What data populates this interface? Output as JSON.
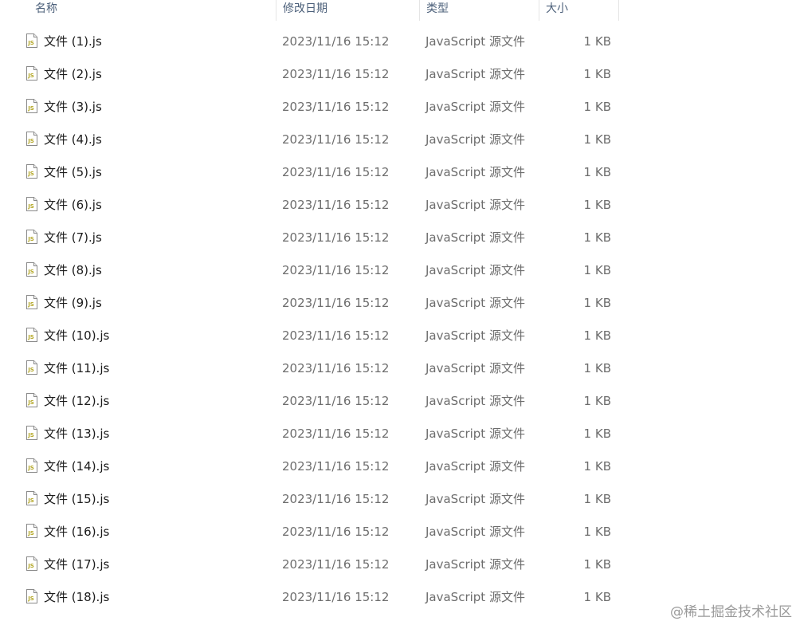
{
  "header": {
    "name": "名称",
    "date": "修改日期",
    "type": "类型",
    "size": "大小"
  },
  "files": [
    {
      "name": "文件 (1).js",
      "date": "2023/11/16 15:12",
      "type": "JavaScript 源文件",
      "size": "1 KB"
    },
    {
      "name": "文件 (2).js",
      "date": "2023/11/16 15:12",
      "type": "JavaScript 源文件",
      "size": "1 KB"
    },
    {
      "name": "文件 (3).js",
      "date": "2023/11/16 15:12",
      "type": "JavaScript 源文件",
      "size": "1 KB"
    },
    {
      "name": "文件 (4).js",
      "date": "2023/11/16 15:12",
      "type": "JavaScript 源文件",
      "size": "1 KB"
    },
    {
      "name": "文件 (5).js",
      "date": "2023/11/16 15:12",
      "type": "JavaScript 源文件",
      "size": "1 KB"
    },
    {
      "name": "文件 (6).js",
      "date": "2023/11/16 15:12",
      "type": "JavaScript 源文件",
      "size": "1 KB"
    },
    {
      "name": "文件 (7).js",
      "date": "2023/11/16 15:12",
      "type": "JavaScript 源文件",
      "size": "1 KB"
    },
    {
      "name": "文件 (8).js",
      "date": "2023/11/16 15:12",
      "type": "JavaScript 源文件",
      "size": "1 KB"
    },
    {
      "name": "文件 (9).js",
      "date": "2023/11/16 15:12",
      "type": "JavaScript 源文件",
      "size": "1 KB"
    },
    {
      "name": "文件 (10).js",
      "date": "2023/11/16 15:12",
      "type": "JavaScript 源文件",
      "size": "1 KB"
    },
    {
      "name": "文件 (11).js",
      "date": "2023/11/16 15:12",
      "type": "JavaScript 源文件",
      "size": "1 KB"
    },
    {
      "name": "文件 (12).js",
      "date": "2023/11/16 15:12",
      "type": "JavaScript 源文件",
      "size": "1 KB"
    },
    {
      "name": "文件 (13).js",
      "date": "2023/11/16 15:12",
      "type": "JavaScript 源文件",
      "size": "1 KB"
    },
    {
      "name": "文件 (14).js",
      "date": "2023/11/16 15:12",
      "type": "JavaScript 源文件",
      "size": "1 KB"
    },
    {
      "name": "文件 (15).js",
      "date": "2023/11/16 15:12",
      "type": "JavaScript 源文件",
      "size": "1 KB"
    },
    {
      "name": "文件 (16).js",
      "date": "2023/11/16 15:12",
      "type": "JavaScript 源文件",
      "size": "1 KB"
    },
    {
      "name": "文件 (17).js",
      "date": "2023/11/16 15:12",
      "type": "JavaScript 源文件",
      "size": "1 KB"
    },
    {
      "name": "文件 (18).js",
      "date": "2023/11/16 15:12",
      "type": "JavaScript 源文件",
      "size": "1 KB"
    }
  ],
  "file_icon": "js-file-icon",
  "colors": {
    "header_text": "#4c607a",
    "name_text": "#1b1b1b",
    "meta_text": "#6d6d6d",
    "icon_accent": "#b5a82a"
  },
  "watermark": "@稀土掘金技术社区"
}
